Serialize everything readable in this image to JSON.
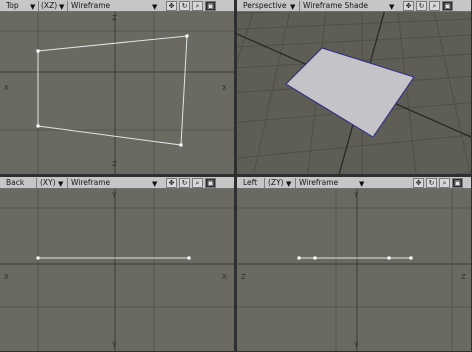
{
  "viewports": {
    "top": {
      "view": "Top",
      "axis": "(XZ)",
      "shading": "Wireframe"
    },
    "perspective": {
      "view": "Perspective",
      "shading": "Wireframe Shade"
    },
    "back": {
      "view": "Back",
      "axis": "(XY)",
      "shading": "Wireframe"
    },
    "left": {
      "view": "Left",
      "axis": "(ZY)",
      "shading": "Wireframe"
    }
  },
  "axis_labels": {
    "x": "X",
    "y": "Y",
    "z": "Z"
  },
  "icons": {
    "dropdown": "dropdown-arrow-icon",
    "move": "move-view-icon",
    "rotate": "rotate-view-icon",
    "zoom": "zoom-view-icon",
    "maximize": "maximize-viewport-icon"
  },
  "colors": {
    "header_bg": "#c6c6c6",
    "viewport_bg": "#6a6a62",
    "grid": "#55554e",
    "wireframe": "#e4e4e4",
    "polygon_fill": "#c3c3c8"
  }
}
